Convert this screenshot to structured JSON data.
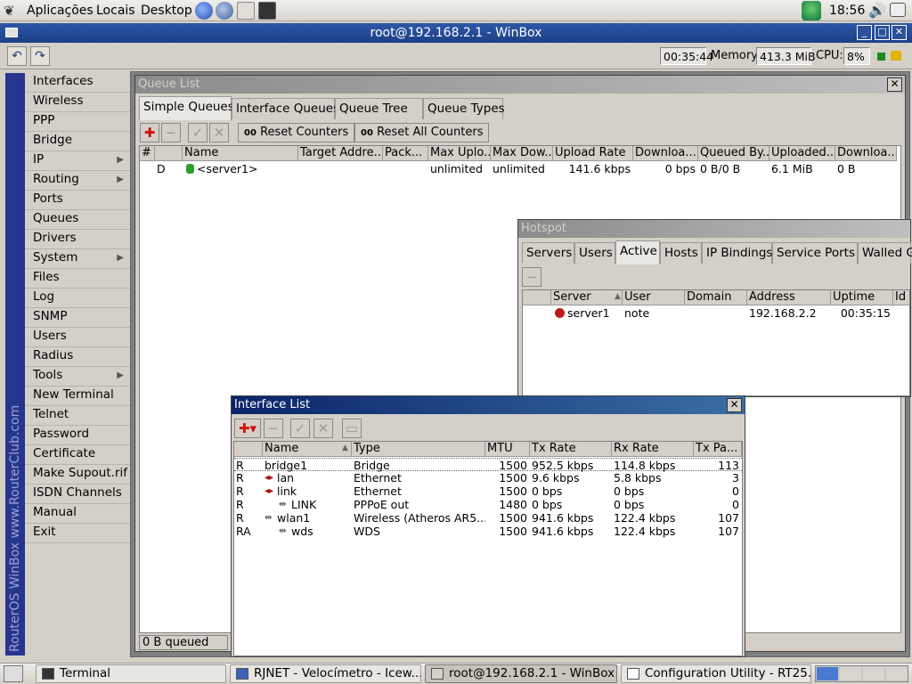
{
  "top_panel": {
    "menus": [
      "Aplicações",
      "Locais",
      "Desktop"
    ],
    "clock": "18:56"
  },
  "window": {
    "title": "root@192.168.2.1 - WinBox"
  },
  "toolbar": {
    "uptime": "00:35:44",
    "memory_label": "Memory:",
    "memory_value": "413.3 MiB",
    "cpu_label": "CPU:",
    "cpu_value": "8%"
  },
  "sidebar": {
    "brand": "RouterOS WinBox   www.RouterClub.com",
    "items": [
      {
        "label": "Interfaces",
        "submenu": false
      },
      {
        "label": "Wireless",
        "submenu": false
      },
      {
        "label": "PPP",
        "submenu": false
      },
      {
        "label": "Bridge",
        "submenu": false
      },
      {
        "label": "IP",
        "submenu": true
      },
      {
        "label": "Routing",
        "submenu": true
      },
      {
        "label": "Ports",
        "submenu": false
      },
      {
        "label": "Queues",
        "submenu": false
      },
      {
        "label": "Drivers",
        "submenu": false
      },
      {
        "label": "System",
        "submenu": true
      },
      {
        "label": "Files",
        "submenu": false
      },
      {
        "label": "Log",
        "submenu": false
      },
      {
        "label": "SNMP",
        "submenu": false
      },
      {
        "label": "Users",
        "submenu": false
      },
      {
        "label": "Radius",
        "submenu": false
      },
      {
        "label": "Tools",
        "submenu": true
      },
      {
        "label": "New Terminal",
        "submenu": false
      },
      {
        "label": "Telnet",
        "submenu": false
      },
      {
        "label": "Password",
        "submenu": false
      },
      {
        "label": "Certificate",
        "submenu": false
      },
      {
        "label": "Make Supout.rif",
        "submenu": false
      },
      {
        "label": "ISDN Channels",
        "submenu": false
      },
      {
        "label": "Manual",
        "submenu": false
      },
      {
        "label": "Exit",
        "submenu": false
      }
    ]
  },
  "queue_list": {
    "title": "Queue List",
    "tabs": [
      "Simple Queues",
      "Interface Queues",
      "Queue Tree",
      "Queue Types"
    ],
    "reset_counters": "Reset Counters",
    "reset_all_counters": "Reset All Counters",
    "counter_icon_text": "00",
    "columns": [
      "#",
      "",
      "Name",
      "Target Addre...",
      "Pack...",
      "Max Uplo...",
      "Max Dow...",
      "Upload Rate",
      "Downloa...",
      "Queued By...",
      "Uploaded...",
      "Downloa..."
    ],
    "rows": [
      {
        "num": "",
        "flag": "D",
        "name": "<server1>",
        "target": "",
        "packet": "",
        "max_up": "unlimited",
        "max_down": "unlimited",
        "upload_rate": "141.6 kbps",
        "download_rate": "0 bps",
        "queued": "0 B/0 B",
        "uploaded": "6.1 MiB",
        "downloaded": "0 B"
      }
    ],
    "status": "0 B queued"
  },
  "hotspot": {
    "title": "Hotspot",
    "tabs": [
      "Servers",
      "Users",
      "Active",
      "Hosts",
      "IP Bindings",
      "Service Ports",
      "Walled G"
    ],
    "columns": [
      "",
      "Server",
      "User",
      "Domain",
      "Address",
      "Uptime",
      "Id"
    ],
    "rows": [
      {
        "server": "server1",
        "user": "note",
        "domain": "",
        "address": "192.168.2.2",
        "uptime": "00:35:15"
      }
    ]
  },
  "interface_list": {
    "title": "Interface List",
    "columns": [
      "",
      "Name",
      "Type",
      "MTU",
      "Tx Rate",
      "Rx Rate",
      "Tx Pa..."
    ],
    "rows": [
      {
        "flag": "R",
        "name": "bridge1",
        "type": "Bridge",
        "mtu": "1500",
        "tx": "952.5 kbps",
        "rx": "114.8 kbps",
        "txp": "113",
        "indent": 0,
        "icon": "none"
      },
      {
        "flag": "R",
        "name": "lan",
        "type": "Ethernet",
        "mtu": "1500",
        "tx": "9.6 kbps",
        "rx": "5.8 kbps",
        "txp": "3",
        "indent": 0,
        "icon": "ethernet"
      },
      {
        "flag": "R",
        "name": "link",
        "type": "Ethernet",
        "mtu": "1500",
        "tx": "0 bps",
        "rx": "0 bps",
        "txp": "0",
        "indent": 0,
        "icon": "ethernet"
      },
      {
        "flag": "R",
        "name": "LINK",
        "type": "PPPoE out",
        "mtu": "1480",
        "tx": "0 bps",
        "rx": "0 bps",
        "txp": "0",
        "indent": 1,
        "icon": "link"
      },
      {
        "flag": "R",
        "name": "wlan1",
        "type": "Wireless (Atheros AR5...",
        "mtu": "1500",
        "tx": "941.6 kbps",
        "rx": "122.4 kbps",
        "txp": "107",
        "indent": 0,
        "icon": "link"
      },
      {
        "flag": "RA",
        "name": "wds",
        "type": "WDS",
        "mtu": "1500",
        "tx": "941.6 kbps",
        "rx": "122.4 kbps",
        "txp": "107",
        "indent": 1,
        "icon": "link"
      }
    ]
  },
  "taskbar": {
    "tasks": [
      "Terminal",
      "RJNET - Velocímetro - Icew...",
      "root@192.168.2.1 - WinBox",
      "Configuration Utility - RT25..."
    ]
  },
  "colors": {
    "title_active": "#0a246a",
    "title_bar": "#1d3f85",
    "brand_bar": "#27358e",
    "workspace": "#808080",
    "window_bg": "#d4d0c8"
  }
}
